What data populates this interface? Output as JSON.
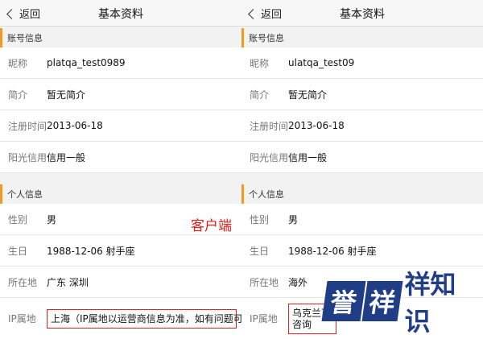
{
  "left": {
    "nav": {
      "back_label": "返回",
      "title": "基本资料"
    },
    "account_section": "账号信息",
    "account_rows": [
      {
        "label": "昵称",
        "value": "platqa_test0989"
      },
      {
        "label": "简介",
        "value": "暂无简介"
      },
      {
        "label": "注册时间",
        "value": "2013-06-18"
      },
      {
        "label": "阳光信用",
        "value": "信用一般"
      }
    ],
    "personal_section": "个人信息",
    "personal_rows": [
      {
        "label": "性别",
        "value": "男"
      },
      {
        "label": "生日",
        "value": "1988-12-06 射手座"
      },
      {
        "label": "所在地",
        "value": "广东 深圳"
      }
    ],
    "ip": {
      "label": "IP属地",
      "value": "上海（IP属地以运营商信息为准，如有问题可咨询客服"
    }
  },
  "right": {
    "nav": {
      "back_label": "返回",
      "title": "基本资料"
    },
    "account_section": "账号信息",
    "account_rows": [
      {
        "label": "昵称",
        "value": "ulatqa_test09"
      },
      {
        "label": "简介",
        "value": "暂无简介"
      },
      {
        "label": "注册时间",
        "value": "2013-06-18"
      },
      {
        "label": "阳光信用",
        "value": "信用一般"
      }
    ],
    "personal_section": "个人信息",
    "personal_rows": [
      {
        "label": "性别",
        "value": "男"
      },
      {
        "label": "生日",
        "value": "1988-12-06 射手座"
      },
      {
        "label": "所在地",
        "value": "海外"
      }
    ],
    "ip": {
      "label": "IP属地",
      "value": "乌克兰可咨询"
    }
  },
  "annotation": "客户端",
  "watermark": {
    "char1": "誉",
    "char2": "祥",
    "text": "祥知识"
  },
  "colors": {
    "accent": "#f29a1d",
    "highlight": "#e02020",
    "watermark": "#1f3e86"
  }
}
